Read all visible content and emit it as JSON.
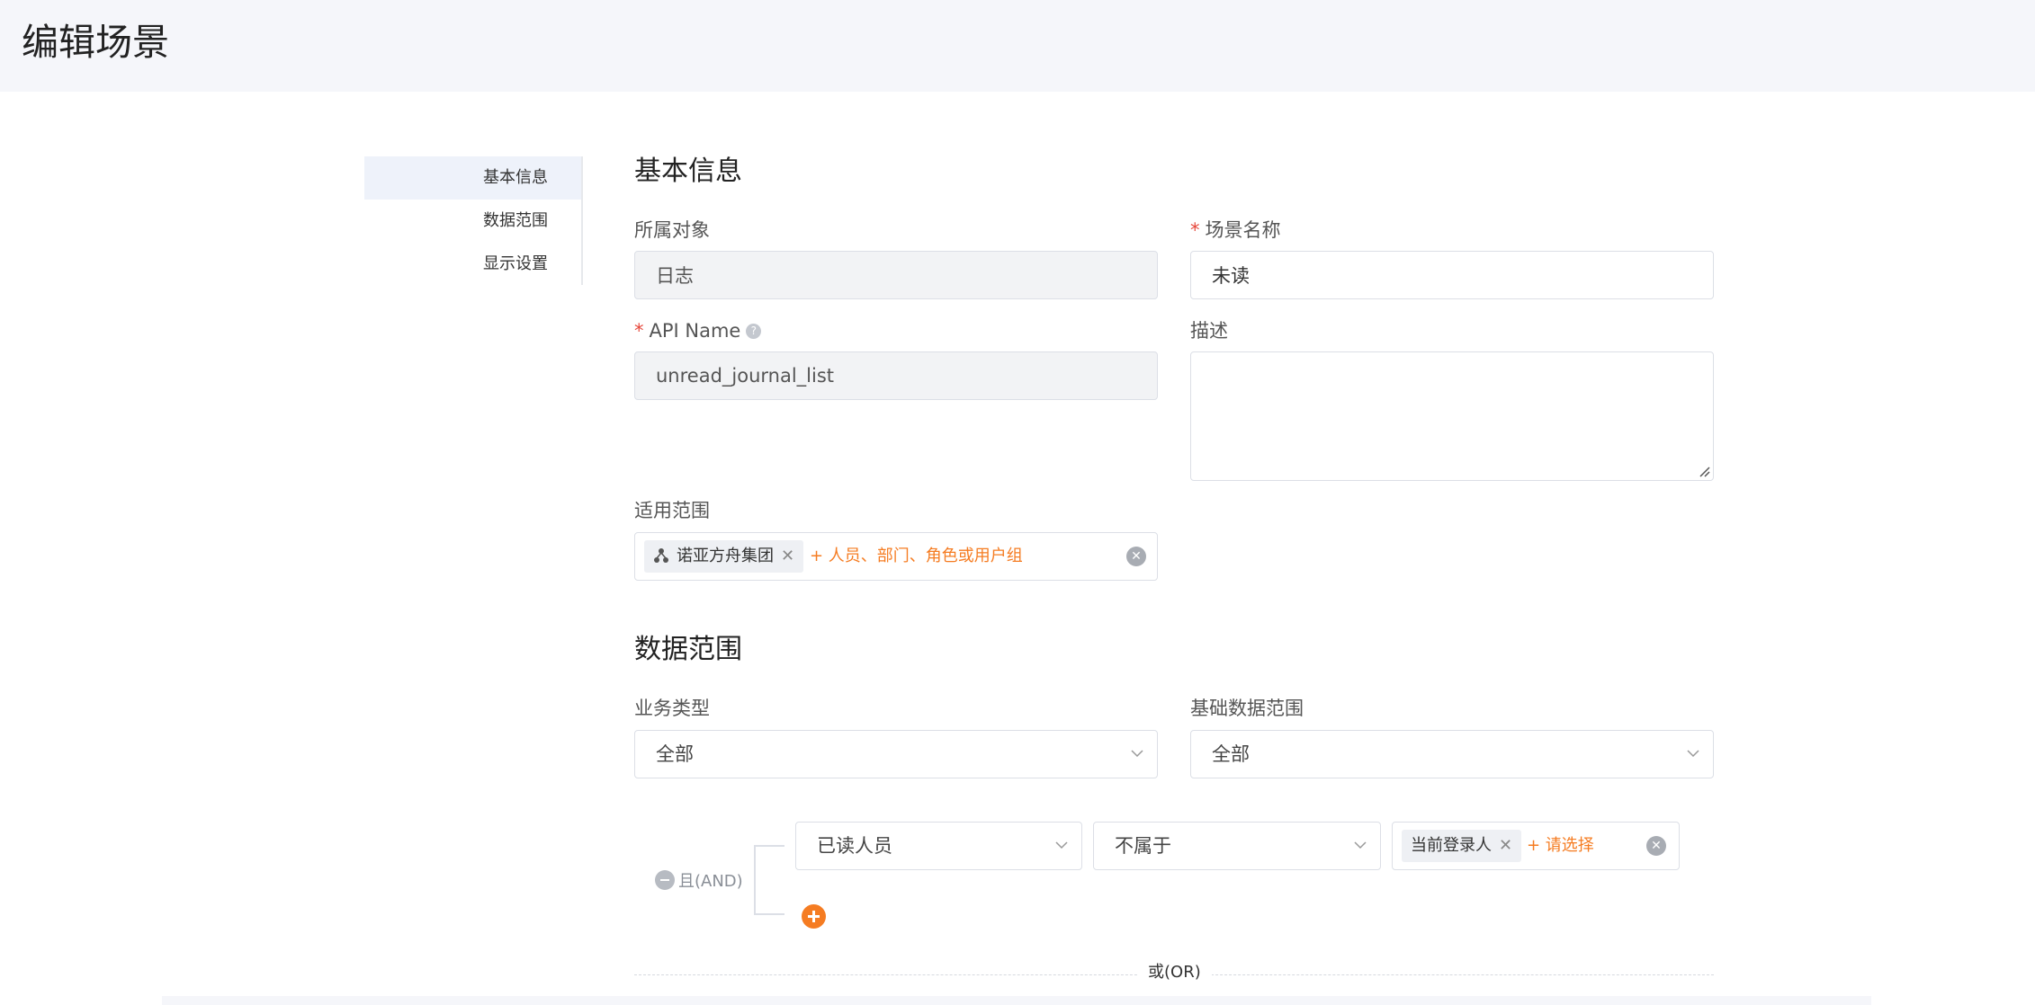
{
  "page": {
    "title": "编辑场景"
  },
  "sidebar": {
    "items": [
      {
        "label": "基本信息",
        "active": true
      },
      {
        "label": "数据范围",
        "active": false
      },
      {
        "label": "显示设置",
        "active": false
      }
    ]
  },
  "basic_info": {
    "section_title": "基本信息",
    "object": {
      "label": "所属对象",
      "value": "日志"
    },
    "scene_name": {
      "label": "场景名称",
      "value": "未读",
      "required": true
    },
    "api_name": {
      "label": "API Name",
      "value": "unread_journal_list",
      "required": true,
      "help_icon": "question-circle-icon"
    },
    "description": {
      "label": "描述",
      "value": ""
    },
    "scope": {
      "label": "适用范围",
      "chip_label": "诺亚方舟集团",
      "chip_icon": "org-tree-icon",
      "remove_symbol": "✕",
      "add_label": "+ 人员、部门、角色或用户组",
      "clear_symbol": "✕"
    }
  },
  "data_range": {
    "section_title": "数据范围",
    "business_type": {
      "label": "业务类型",
      "value": "全部"
    },
    "base_range": {
      "label": "基础数据范围",
      "value": "全部"
    },
    "condition": {
      "group_label": "且(AND)",
      "field": "已读人员",
      "operator": "不属于",
      "value_chip": "当前登录人",
      "remove_symbol": "✕",
      "add_label": "+ 请选择",
      "clear_symbol": "✕"
    },
    "or_label": "或(OR)"
  },
  "colors": {
    "accent": "#f57c22",
    "required": "#e6473b",
    "header_bg": "#f5f6fa",
    "nav_active_bg": "#eef2fa"
  }
}
